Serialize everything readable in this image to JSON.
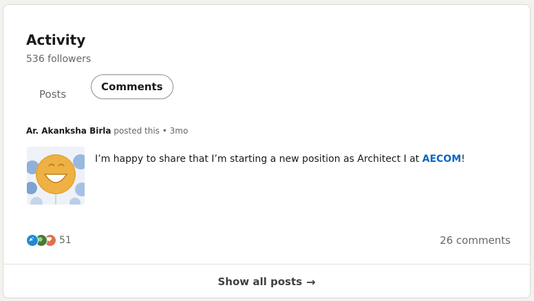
{
  "activity": {
    "title": "Activity",
    "followers": "536 followers"
  },
  "tabs": [
    {
      "label": "Posts",
      "selected": false
    },
    {
      "label": "Comments",
      "selected": true
    }
  ],
  "post": {
    "author": "Ar. Akanksha Birla",
    "meta_suffix": " posted this • 3mo",
    "text_before": "I’m happy to share that I’m starting a new position as Architect I at ",
    "company": "AECOM",
    "text_after": "!",
    "reactions": {
      "icons": [
        "celebrate-icon",
        "support-icon",
        "love-icon"
      ],
      "count": "51"
    },
    "comments": "26 comments"
  },
  "footer": {
    "show_all": "Show all posts",
    "arrow": "→"
  },
  "colors": {
    "accent": "#0a66c2",
    "celebrate": "#1e8ad6",
    "support": "#467a3c",
    "love": "#df704d"
  }
}
